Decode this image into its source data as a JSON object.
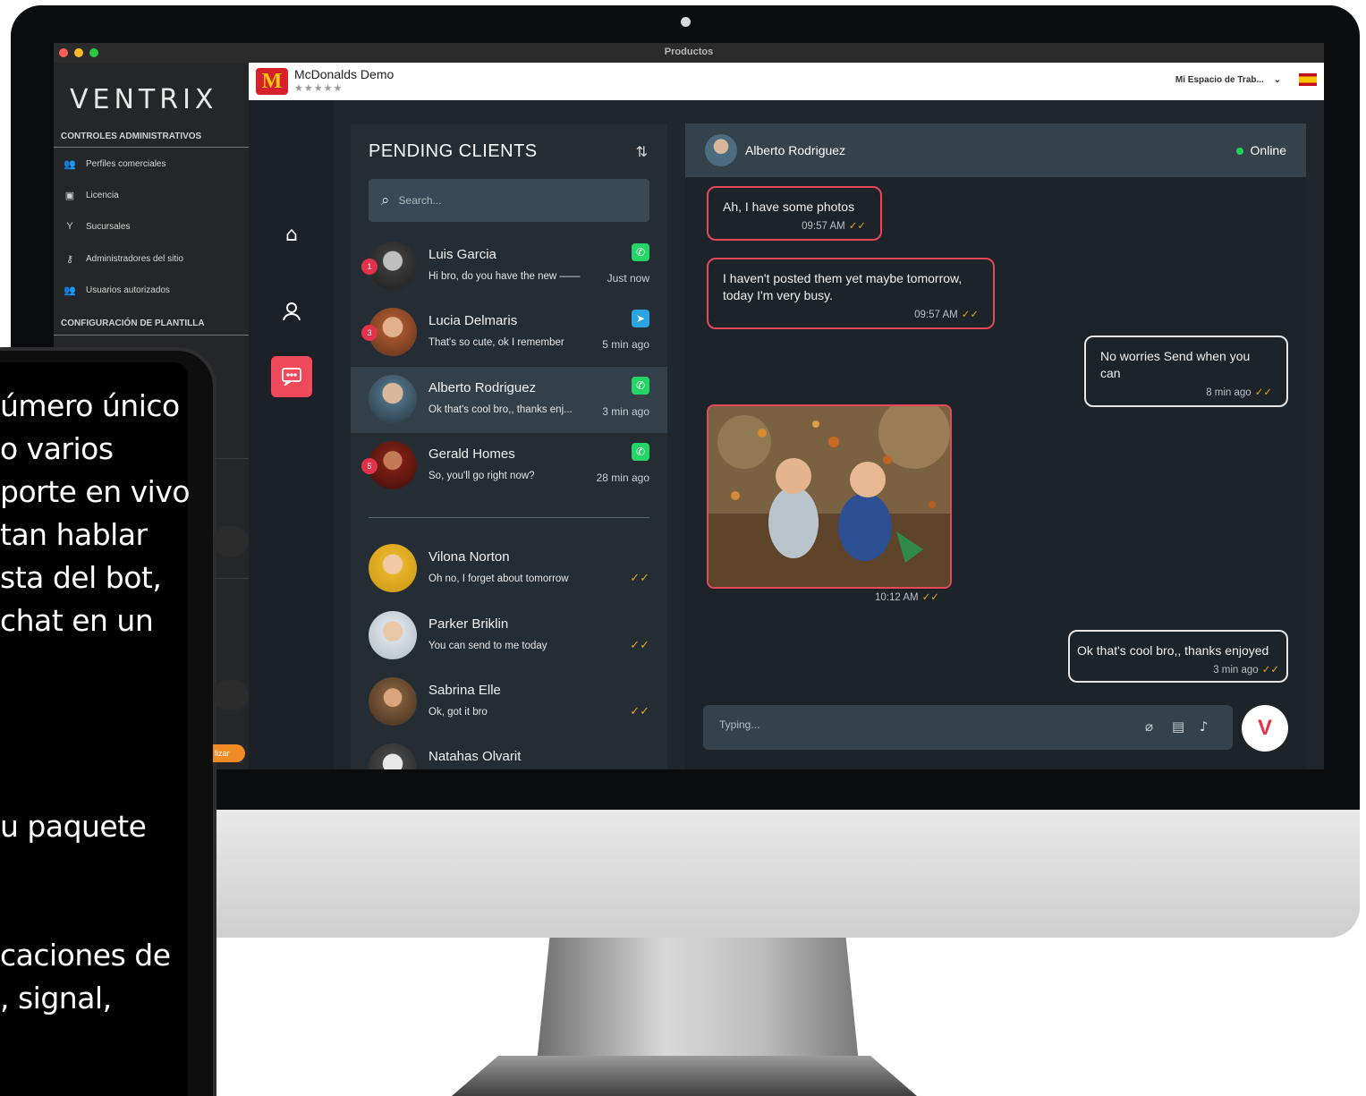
{
  "titlebar": {
    "title": "Productos"
  },
  "admin_sidebar": {
    "logo": "VENTRIX",
    "section_admin": "CONTROLES ADMINISTRATIVOS",
    "items": [
      {
        "label": "Perfiles comerciales",
        "icon": "users-icon"
      },
      {
        "label": "Licencia",
        "icon": "document-icon"
      },
      {
        "label": "Sucursales",
        "icon": "branch-icon"
      },
      {
        "label": "Administradores del sitio",
        "icon": "admin-key-icon"
      },
      {
        "label": "Usuarios autorizados",
        "icon": "users-icon"
      }
    ],
    "section_template": "CONFIGURACIÓN DE PLANTILLA"
  },
  "header": {
    "brand_name": "McDonalds Demo",
    "brand_logo_text": "M",
    "stars": "★★★★★",
    "workspace": "Mi Espacio de Trab...",
    "workspace_chevron": "⌄"
  },
  "rail": {
    "icons": [
      "home-icon",
      "user-icon",
      "chat-icon"
    ]
  },
  "clients": {
    "title": "PENDING CLIENTS",
    "search_placeholder": "Search...",
    "items": [
      {
        "name": "Luis Garcia",
        "message": "Hi bro, do you have the new ——",
        "time": "Just now",
        "badge": "1",
        "channel": "whatsapp"
      },
      {
        "name": "Lucia Delmaris",
        "message": "That's so cute, ok I remember",
        "time": "5 min ago",
        "badge": "3",
        "channel": "telegram"
      },
      {
        "name": "Alberto Rodriguez",
        "message": "Ok that's cool bro,, thanks enj...",
        "time": "3 min ago",
        "badge": "",
        "channel": "whatsapp"
      },
      {
        "name": "Gerald Homes",
        "message": "So, you'll go right now?",
        "time": "28 min ago",
        "badge": "5",
        "channel": "whatsapp"
      },
      {
        "name": "Vilona Norton",
        "message": "Oh no, I forget about tomorrow",
        "time": "",
        "badge": "",
        "channel": ""
      },
      {
        "name": "Parker Briklin",
        "message": "You can send to me today",
        "time": "",
        "badge": "",
        "channel": ""
      },
      {
        "name": "Sabrina Elle",
        "message": "Ok, got it bro",
        "time": "",
        "badge": "",
        "channel": ""
      },
      {
        "name": "Natahas Olvarit",
        "message": "",
        "time": "",
        "badge": "",
        "channel": ""
      }
    ]
  },
  "chat": {
    "contact_name": "Alberto Rodriguez",
    "status": "Online",
    "messages": [
      {
        "dir": "in",
        "text": "Ah, I have some photos",
        "time": "09:57 AM"
      },
      {
        "dir": "in",
        "text": "I haven't posted them yet maybe tomorrow, today I'm very busy.",
        "time": "09:57 AM"
      },
      {
        "dir": "out",
        "text": "No worries Send when you can",
        "time": "8 min ago"
      },
      {
        "dir": "in",
        "type": "image",
        "time": "10:12 AM"
      },
      {
        "dir": "out",
        "text": "Ok that's cool bro,, thanks enjoyed",
        "time": "3 min ago"
      }
    ],
    "composer_placeholder": "Typing...",
    "composer_icons": [
      "attach-icon",
      "file-icon",
      "mic-icon"
    ],
    "send_icon": "ventrix-send-icon"
  },
  "promo": {
    "lines": [
      "úmero único",
      "o varios",
      "porte en vivo",
      "tan hablar",
      "sta del bot,",
      " chat en un",
      "u paquete",
      "caciones de",
      ", signal,"
    ],
    "device_button": "lizar"
  },
  "colors": {
    "accent": "#ef4a5b",
    "whatsapp": "#25d366",
    "telegram": "#2aa3e0",
    "online": "#23d160",
    "read_tick": "#e3a51d"
  }
}
